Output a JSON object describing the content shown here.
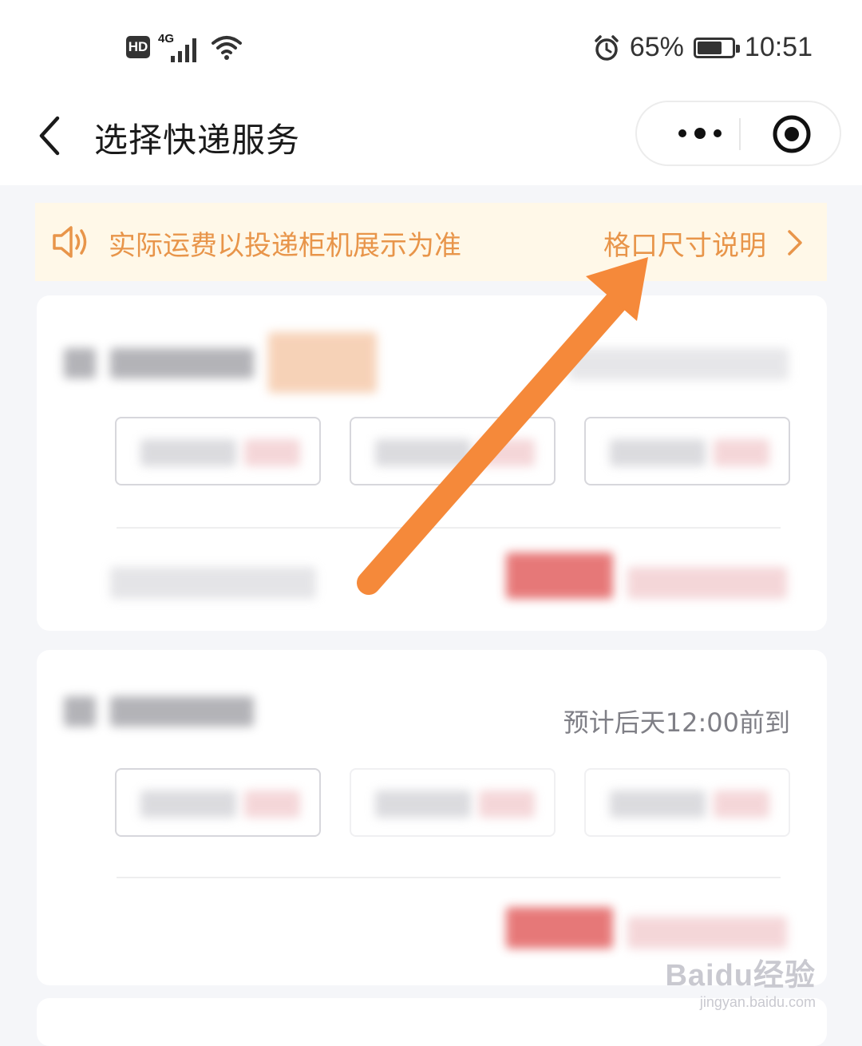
{
  "status_bar": {
    "hd": "HD",
    "network": "4G",
    "battery_percent": "65%",
    "time": "10:51"
  },
  "navbar": {
    "title": "选择快递服务"
  },
  "notice": {
    "text": "实际运费以投递柜机展示为准",
    "link": "格口尺寸说明"
  },
  "card2": {
    "eta": "预计后天12:00前到"
  },
  "watermark": {
    "logo": "Baidu经验",
    "url": "jingyan.baidu.com"
  },
  "colors": {
    "accent_orange": "#e8954a",
    "arrow_orange": "#f5893a",
    "notice_bg": "#fff8e8"
  }
}
